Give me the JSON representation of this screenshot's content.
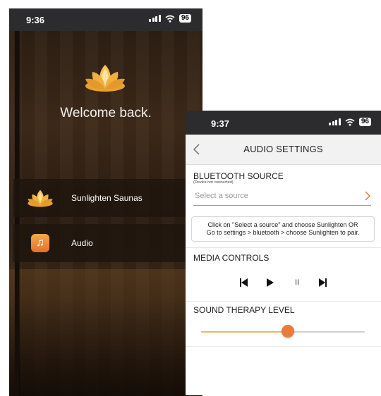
{
  "left_screen": {
    "status_time": "9:36",
    "battery": "96",
    "welcome_text": "Welcome back.",
    "menu": [
      {
        "label": "Sunlighten Saunas",
        "icon": "lotus-icon"
      },
      {
        "label": "Audio",
        "icon": "music-note-icon"
      }
    ]
  },
  "right_screen": {
    "status_time": "9:37",
    "battery": "96",
    "title": "AUDIO SETTINGS",
    "bluetooth": {
      "heading": "BLUETOOTH SOURCE",
      "status": "(Device not connected)",
      "placeholder": "Select a source",
      "help_line1": "Click on \"Select a source\" and choose Sunlighten OR",
      "help_line2": "Go to settings > bluetooth > choose Sunlighten to pair."
    },
    "media": {
      "heading": "MEDIA CONTROLS",
      "pause_glyph": "II"
    },
    "sound_therapy": {
      "heading": "SOUND THERAPY LEVEL",
      "level": 0.53
    },
    "colors": {
      "accent": "#ec7a3a",
      "slider_fill": "#f2b45a"
    }
  }
}
